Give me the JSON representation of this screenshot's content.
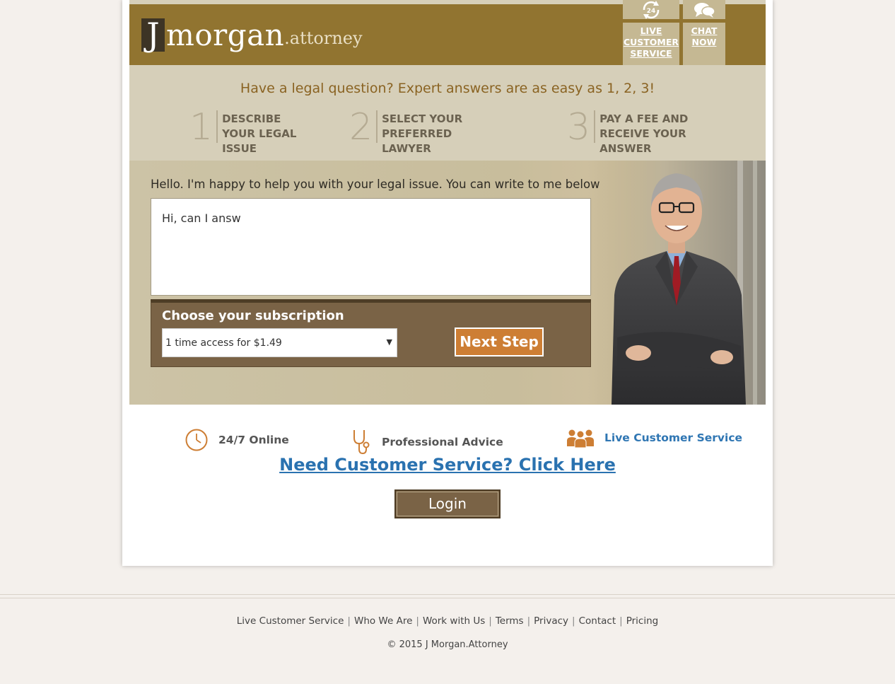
{
  "header": {
    "logo_letter": "J",
    "logo_main": "morgan",
    "logo_suffix": ".attorney",
    "live_service_label": "LIVE CUSTOMER SERVICE",
    "chat_label": "CHAT NOW",
    "badge_24": "24"
  },
  "steps": {
    "title": "Have a legal question? Expert answers are as easy as 1, 2, 3!",
    "items": [
      {
        "num": "1",
        "text": "DESCRIBE YOUR LEGAL ISSUE"
      },
      {
        "num": "2",
        "text": "SELECT YOUR PREFERRED LAWYER"
      },
      {
        "num": "3",
        "text": "PAY A FEE AND RECEIVE YOUR ANSWER"
      }
    ]
  },
  "hero": {
    "greeting": "Hello. I'm happy to help you with your legal issue. You can write to me below",
    "message_value": "Hi, can I answ",
    "subscription_title": "Choose your subscription",
    "subscription_selected": "1 time access for $1.49",
    "next_label": "Next Step"
  },
  "features": [
    {
      "label": "24/7 Online",
      "icon": "clock-icon"
    },
    {
      "label": "Professional Advice",
      "icon": "stethoscope-icon"
    },
    {
      "label": "Live Customer Service",
      "icon": "people-icon"
    }
  ],
  "cs_link": "Need Customer Service? Click Here",
  "login_label": "Login",
  "footer": {
    "links": [
      "Live Customer Service",
      "Who We Are",
      "Work with Us",
      "Terms",
      "Privacy",
      "Contact",
      "Pricing"
    ],
    "copyright": "© 2015 J Morgan.Attorney"
  },
  "colors": {
    "header": "#917430",
    "band": "#d6cfb9",
    "accent": "#cd7e34",
    "panel": "#7a6346",
    "link": "#2a72b0"
  }
}
